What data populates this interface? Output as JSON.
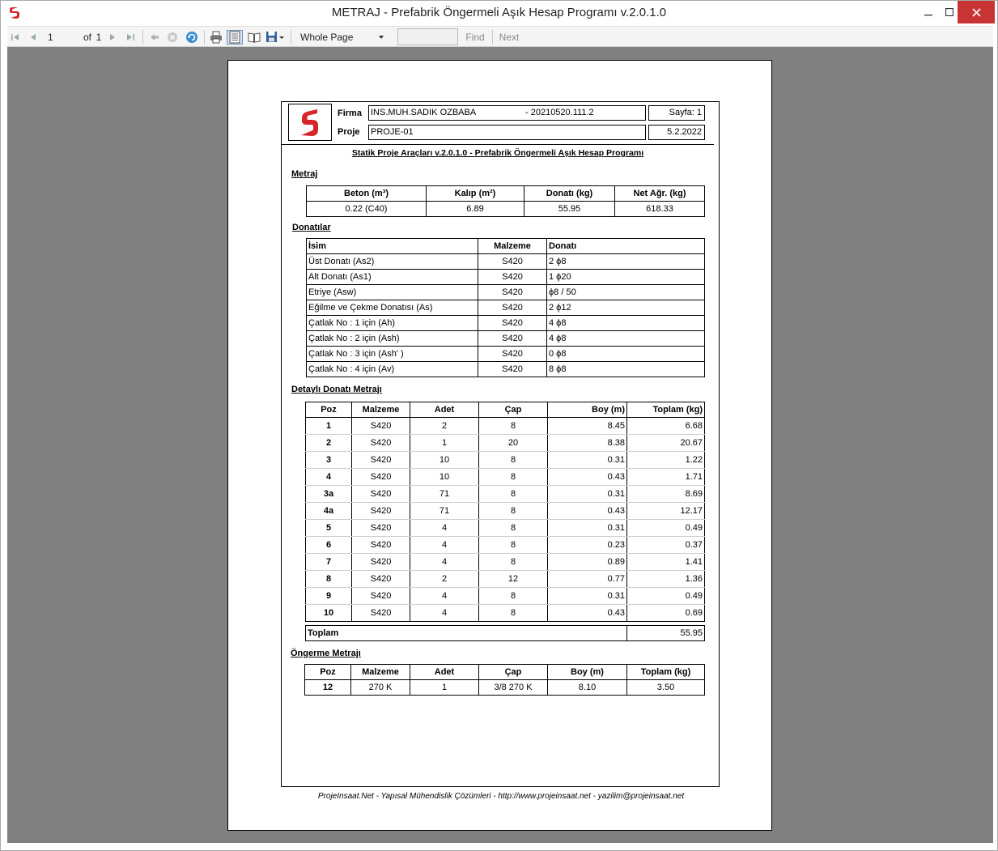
{
  "window": {
    "title": "METRAJ - Prefabrik Öngermeli Aşık Hesap Programı v.2.0.1.0"
  },
  "toolbar": {
    "page_current": "1",
    "page_of": "of",
    "page_total": "1",
    "zoom": "Whole Page",
    "find_label": "Find",
    "next_label": "Next",
    "find_placeholder": ""
  },
  "report": {
    "header": {
      "firma_label": "Firma",
      "firma_value": "INS.MUH.SADIK OZBABA",
      "firma_code": "- 20210520.111.2",
      "proje_label": "Proje",
      "proje_value": "PROJE-01",
      "sayfa": "Sayfa: 1",
      "date": "5.2.2022"
    },
    "subtitle": "Statik Proje Araçları v.2.0.1.0 - Prefabrik Öngermeli Aşık Hesap Programı",
    "metraj": {
      "section_title": "Metraj",
      "headers": [
        "Beton (m³)",
        "Kalıp (m²)",
        "Donatı (kg)",
        "Net Ağr. (kg)"
      ],
      "values": [
        "0.22 (C40)",
        "6.89",
        "55.95",
        "618.33"
      ]
    },
    "donatilar": {
      "section_title": "Donatılar",
      "headers": [
        "İsim",
        "Malzeme",
        "Donatı"
      ],
      "rows": [
        [
          "Üst Donatı (As2)",
          "S420",
          "2 ϕ8"
        ],
        [
          "Alt Donatı (As1)",
          "S420",
          "1 ϕ20"
        ],
        [
          "Etriye (Asw)",
          "S420",
          "ϕ8 / 50"
        ],
        [
          "Eğilme ve Çekme Donatısı (As)",
          "S420",
          "2 ϕ12"
        ],
        [
          "Çatlak No : 1 için (Ah)",
          "S420",
          "4 ϕ8"
        ],
        [
          "Çatlak No : 2 için (Ash)",
          "S420",
          "4 ϕ8"
        ],
        [
          "Çatlak No : 3 için (Ash' )",
          "S420",
          "0 ϕ8"
        ],
        [
          "Çatlak No : 4 için (Av)",
          "S420",
          "8 ϕ8"
        ]
      ]
    },
    "detayli": {
      "section_title": "Detaylı Donatı Metrajı",
      "headers": [
        "Poz",
        "Malzeme",
        "Adet",
        "Çap",
        "Boy (m)",
        "Toplam (kg)"
      ],
      "rows": [
        [
          "1",
          "S420",
          "2",
          "8",
          "8.45",
          "6.68"
        ],
        [
          "2",
          "S420",
          "1",
          "20",
          "8.38",
          "20.67"
        ],
        [
          "3",
          "S420",
          "10",
          "8",
          "0.31",
          "1.22"
        ],
        [
          "4",
          "S420",
          "10",
          "8",
          "0.43",
          "1.71"
        ],
        [
          "3a",
          "S420",
          "71",
          "8",
          "0.31",
          "8.69"
        ],
        [
          "4a",
          "S420",
          "71",
          "8",
          "0.43",
          "12.17"
        ],
        [
          "5",
          "S420",
          "4",
          "8",
          "0.31",
          "0.49"
        ],
        [
          "6",
          "S420",
          "4",
          "8",
          "0.23",
          "0.37"
        ],
        [
          "7",
          "S420",
          "4",
          "8",
          "0.89",
          "1.41"
        ],
        [
          "8",
          "S420",
          "2",
          "12",
          "0.77",
          "1.36"
        ],
        [
          "9",
          "S420",
          "4",
          "8",
          "0.31",
          "0.49"
        ],
        [
          "10",
          "S420",
          "4",
          "8",
          "0.43",
          "0.69"
        ]
      ],
      "total_label": "Toplam",
      "total_value": "55.95"
    },
    "ongerme": {
      "section_title": "Öngerme Metrajı",
      "headers": [
        "Poz",
        "Malzeme",
        "Adet",
        "Çap",
        "Boy (m)",
        "Toplam (kg)"
      ],
      "rows": [
        [
          "12",
          "270 K",
          "1",
          "3/8 270 K",
          "8.10",
          "3.50"
        ]
      ]
    },
    "footer": "ProjeInsaat.Net - Yapısal Mühendislik Çözümleri - http://www.projeinsaat.net - yazilim@projeinsaat.net"
  },
  "colors": {
    "brand_red": "#d7262a",
    "viewer_bg": "#808080",
    "close_button": "#c83434"
  }
}
